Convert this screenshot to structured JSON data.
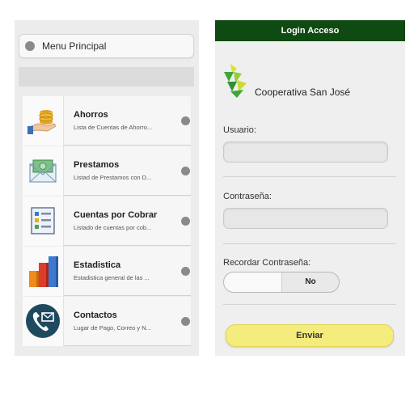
{
  "menu": {
    "title": "Menu Principal",
    "items": [
      {
        "label": "Ahorros",
        "subtitle": "Lista de Cuentas de Ahorro...",
        "icon": "coins-hand-icon"
      },
      {
        "label": "Prestamos",
        "subtitle": "Listad de Prestamos con D...",
        "icon": "money-envelope-icon"
      },
      {
        "label": "Cuentas por Cobrar",
        "subtitle": "Listado de cuentas por cob...",
        "icon": "checklist-icon"
      },
      {
        "label": "Estadistica",
        "subtitle": "Estadistica general de las ...",
        "icon": "bar-chart-icon"
      },
      {
        "label": "Contactos",
        "subtitle": "Lugar de Pago, Correo y N...",
        "icon": "phone-mail-icon"
      }
    ]
  },
  "login": {
    "header": "Login Acceso",
    "brand": "Cooperativa San José",
    "username_label": "Usuario:",
    "username_value": "",
    "password_label": "Contraseña:",
    "password_value": "",
    "remember_label": "Recordar Contraseña:",
    "remember_state": "No",
    "submit_label": "Enviar"
  },
  "colors": {
    "header_green": "#0f4a12",
    "button_yellow": "#f4ec7c",
    "logo_green": "#3fa63a",
    "logo_yellow": "#d7e23a"
  }
}
